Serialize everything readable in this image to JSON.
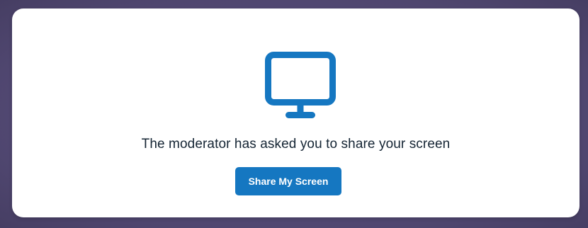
{
  "dialog": {
    "icon": "monitor-icon",
    "message": "The moderator has asked you to share your screen",
    "share_button_label": "Share My Screen"
  },
  "colors": {
    "accent": "#1577c1",
    "text": "#152534",
    "card_background": "#ffffff",
    "page_background": "#544b78"
  }
}
